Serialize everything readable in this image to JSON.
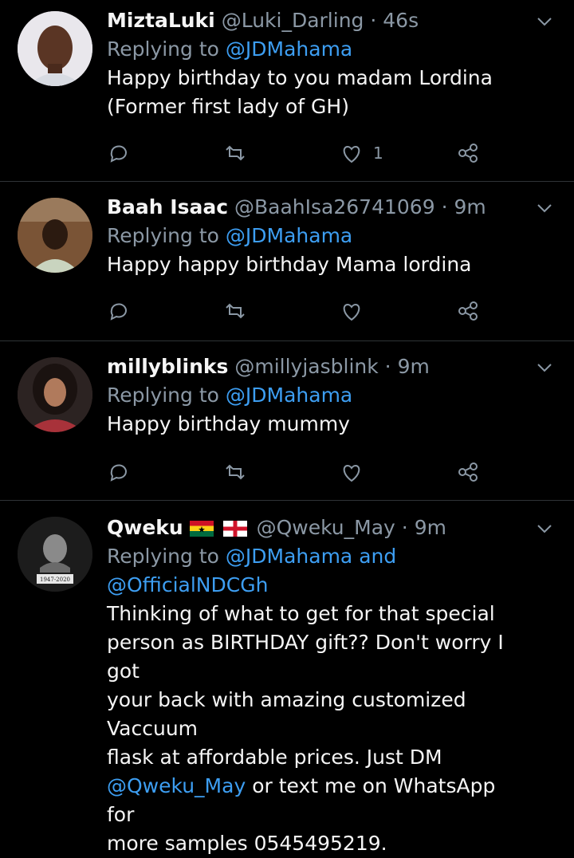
{
  "tweets": [
    {
      "name": "MiztaLuki",
      "handle": "@Luki_Darling",
      "time": "· 46s",
      "replying_prefix": "Replying to",
      "replying_to": "@JDMahama",
      "text_lines": [
        "Happy birthday to you madam Lordina",
        "(Former first lady of GH)"
      ],
      "like_count": "1"
    },
    {
      "name": "Baah Isaac",
      "handle": "@BaahIsa26741069",
      "time": "· 9m",
      "replying_prefix": "Replying to",
      "replying_to": "@JDMahama",
      "text_lines": [
        "Happy happy birthday Mama lordina"
      ]
    },
    {
      "name": "millyblinks",
      "handle": "@millyjasblink",
      "time": "· 9m",
      "replying_prefix": "Replying to",
      "replying_to": "@JDMahama",
      "text_lines": [
        "Happy birthday mummy"
      ]
    },
    {
      "name": "Qweku",
      "flags": [
        "ghana-flag",
        "england-flag"
      ],
      "handle": "@Qweku_May",
      "time": "· 9m",
      "replying_prefix": "Replying to",
      "replying_to": "@JDMahama and",
      "replying_to_2": "@OfficialNDCGh",
      "text_lines": [
        "Thinking of what to get for that special",
        "person as BIRTHDAY gift?? Don't worry I got",
        "your back with amazing customized Vaccuum",
        "flask at affordable prices. Just DM"
      ],
      "mention": "@Qweku_May",
      "text_after_mention": " or text me on WhatsApp for",
      "text_last_line": "more samples 0545495219.",
      "avatar_caption": "1947-2020"
    }
  ],
  "colors": {
    "background": "#000000",
    "link": "#3d9ef2",
    "secondary": "#8b98a5",
    "divider": "#2f3336"
  },
  "icons": [
    "reply-icon",
    "retweet-icon",
    "like-icon",
    "share-icon",
    "chevron-down-icon"
  ]
}
